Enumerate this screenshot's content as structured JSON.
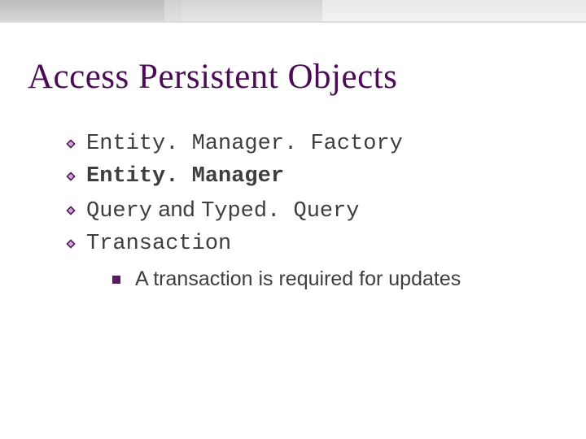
{
  "title": "Access Persistent Objects",
  "items": {
    "a": "Entity. Manager. Factory",
    "b": "Entity. Manager",
    "c1": "Query",
    "c_mid": " and ",
    "c2": "Typed. Query",
    "d": "Transaction"
  },
  "sub": {
    "a": "A transaction is required for updates"
  }
}
